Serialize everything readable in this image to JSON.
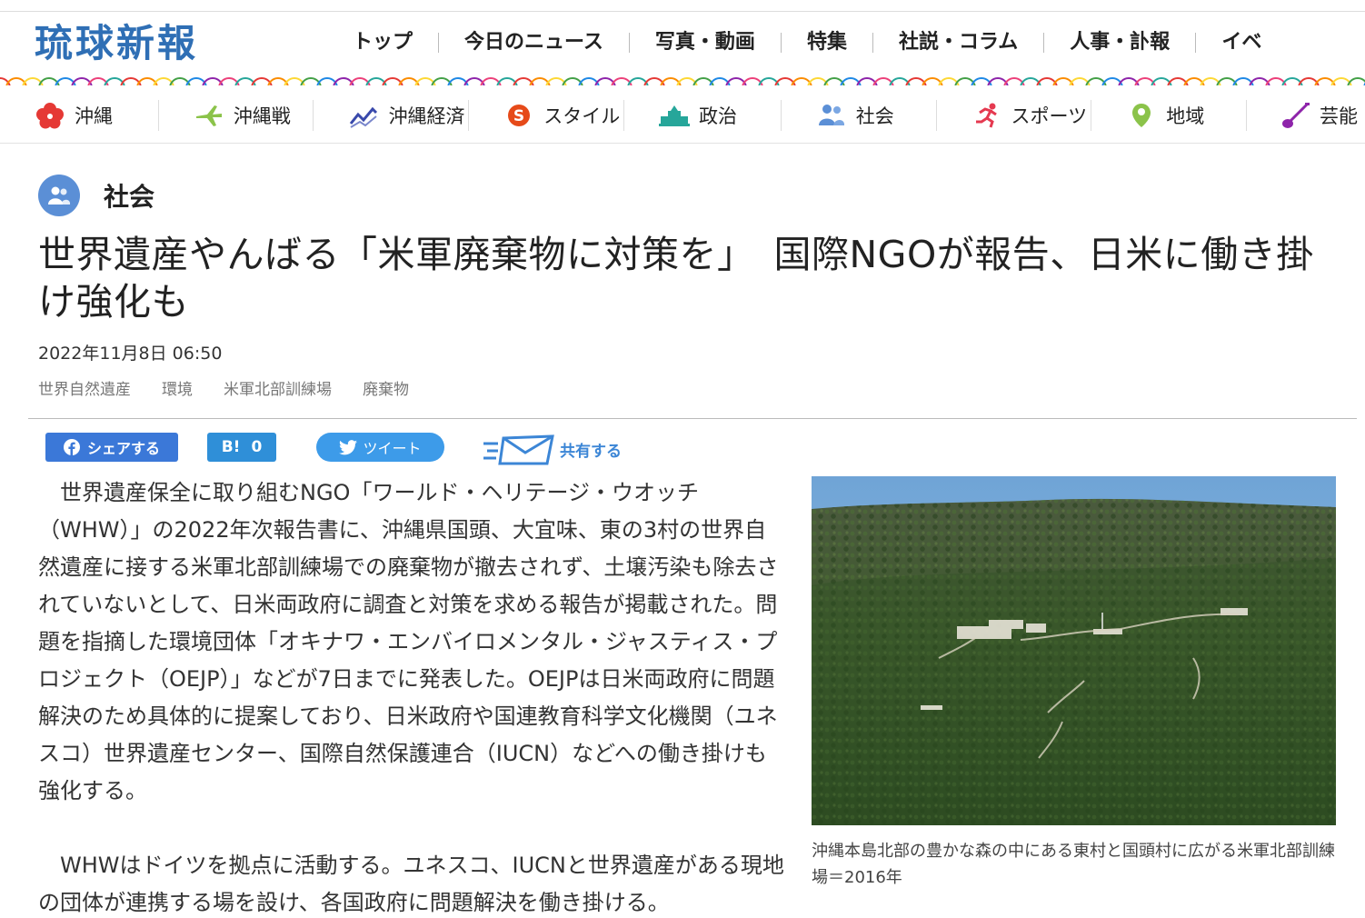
{
  "site": {
    "logo_text": "琉球新報"
  },
  "top_nav": [
    "トップ",
    "今日のニュース",
    "写真・動画",
    "特集",
    "社説・コラム",
    "人事・訃報",
    "イベ"
  ],
  "category_nav": [
    {
      "label": "沖縄",
      "icon": "hibiscus-icon",
      "color": "#e53935"
    },
    {
      "label": "沖縄戦",
      "icon": "plane-icon",
      "color": "#8bc34a"
    },
    {
      "label": "沖縄経済",
      "icon": "trend-chart-icon",
      "color": "#3949ab"
    },
    {
      "label": "スタイル",
      "icon": "style-s-icon",
      "color": "#e64a19"
    },
    {
      "label": "政治",
      "icon": "parliament-icon",
      "color": "#26a69a"
    },
    {
      "label": "社会",
      "icon": "people-icon",
      "color": "#5b8fd6"
    },
    {
      "label": "スポーツ",
      "icon": "runner-icon",
      "color": "#e53950"
    },
    {
      "label": "地域",
      "icon": "map-pin-icon",
      "color": "#8bc34a"
    },
    {
      "label": "芸能・",
      "icon": "sanshin-icon",
      "color": "#8e24aa"
    }
  ],
  "article": {
    "section": "社会",
    "section_color": "#5b8fd6",
    "title": "世界遺産やんばる「米軍廃棄物に対策を」　国際NGOが報告、日米に働き掛け強化も",
    "datetime": "2022年11月8日 06:50",
    "tags": [
      "世界自然遺産",
      "環境",
      "米軍北部訓練場",
      "廃棄物"
    ],
    "paragraphs": [
      "世界遺産保全に取り組むNGO「ワールド・ヘリテージ・ウオッチ（WHW）」の2022年次報告書に、沖縄県国頭、大宜味、東の3村の世界自然遺産に接する米軍北部訓練場での廃棄物が撤去されず、土壌汚染も除去されていないとして、日米両政府に調査と対策を求める報告が掲載された。問題を指摘した環境団体「オキナワ・エンバイロメンタル・ジャスティス・プロジェクト（OEJP）」などが7日までに発表した。OEJPは日米両政府に問題解決のため具体的に提案しており、日米政府や国連教育科学文化機関（ユネスコ）世界遺産センター、国際自然保護連合（IUCN）などへの働き掛けも強化する。",
      "WHWはドイツを拠点に活動する。ユネスコ、IUCNと世界遺産がある現地の団体が連携する場を設け、各国政府に問題解決を働き掛ける。"
    ],
    "photo_caption": "沖縄本島北部の豊かな森の中にある東村と国頭村に広がる米軍北部訓練場＝2016年"
  },
  "share": {
    "facebook_label": "シェアする",
    "hatena_label": "B!",
    "hatena_count": "0",
    "twitter_label": "ツイート",
    "mail_label": "共有する"
  }
}
